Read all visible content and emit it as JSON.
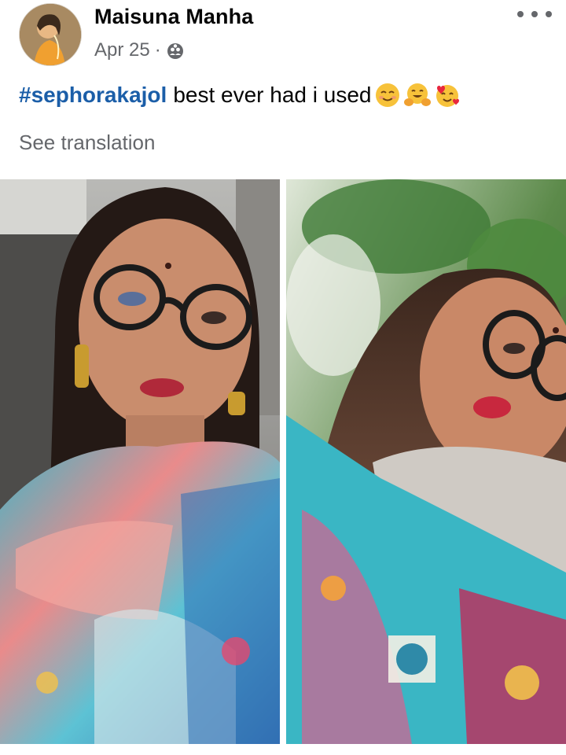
{
  "post": {
    "author": {
      "name": "Maisuna Manha",
      "avatar_icon": "profile-photo"
    },
    "date": "Apr 25",
    "separator": "·",
    "audience_icon": "friends-icon",
    "more_icon": "more-horizontal-icon",
    "text": {
      "hashtag": "#sephorakajol",
      "body": "best ever had i used",
      "emojis": [
        "smiling-face-emoji",
        "hugging-face-emoji",
        "smiling-face-with-hearts-emoji"
      ]
    },
    "see_translation": "See translation",
    "photos": [
      {
        "name": "photo-left",
        "subject": "selfie-indoor"
      },
      {
        "name": "photo-right",
        "subject": "selfie-outdoor"
      }
    ]
  },
  "colors": {
    "hashtag": "#1b5ea8",
    "secondary_text": "#65676b",
    "primary_text": "#050505"
  }
}
